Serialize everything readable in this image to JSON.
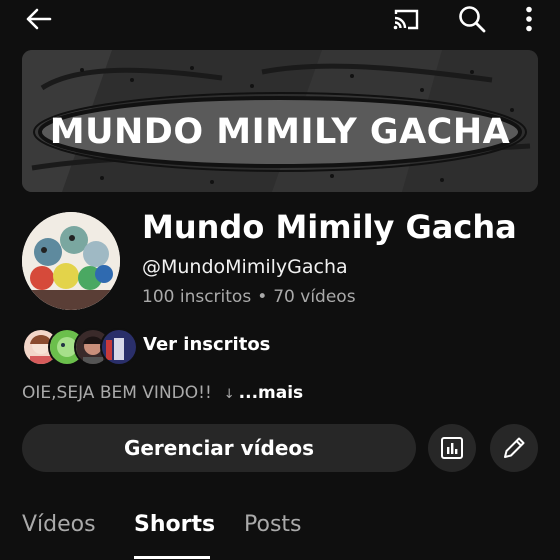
{
  "header": {
    "back_icon": "arrow-left-icon",
    "cast_icon": "cast-icon",
    "search_icon": "search-icon",
    "more_icon": "more-vertical-icon"
  },
  "banner": {
    "title": "MUNDO MIMILY GACHA"
  },
  "channel": {
    "name": "Mundo Mimily Gacha",
    "handle": "@MundoMimilyGacha",
    "subscribers": "100 inscritos",
    "separator": "•",
    "videos": "70 vídeos"
  },
  "subscribers_preview": {
    "label": "Ver inscritos"
  },
  "description": {
    "text": "OIE,SEJA BEM VINDO!!",
    "arrow": "↓",
    "more_label": "...mais"
  },
  "actions": {
    "manage_label": "Gerenciar vídeos",
    "analytics_icon": "analytics-icon",
    "edit_icon": "pencil-icon"
  },
  "tabs": [
    {
      "label": "Vídeos",
      "active": false
    },
    {
      "label": "Shorts",
      "active": true
    },
    {
      "label": "Posts",
      "active": false
    }
  ],
  "colors": {
    "background": "#0f0f0f",
    "button_bg": "#272727",
    "secondary_text": "#aaaaaa",
    "primary_text": "#ffffff"
  }
}
